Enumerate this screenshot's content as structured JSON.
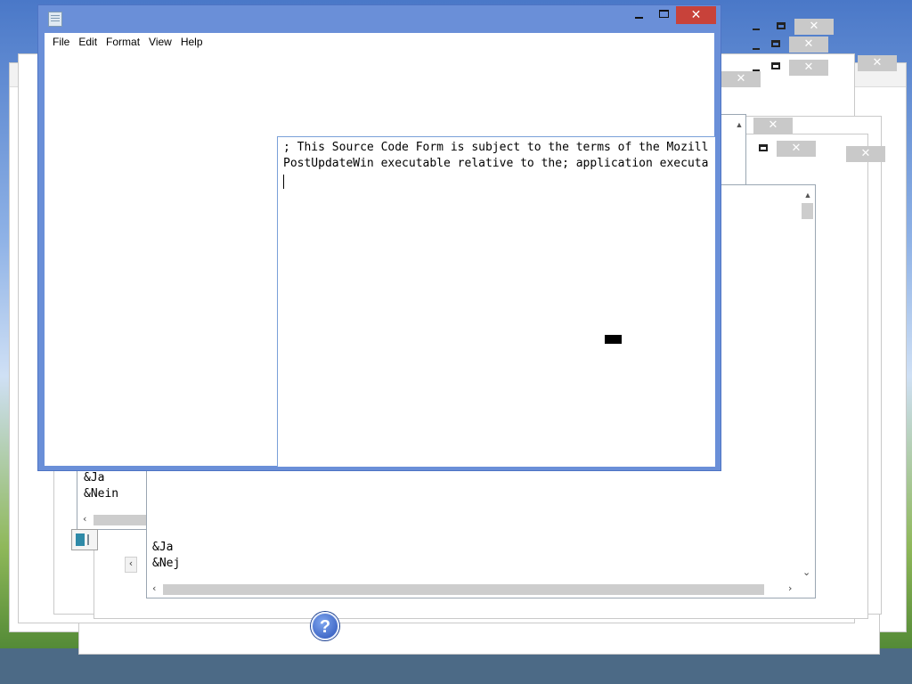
{
  "main_window": {
    "menu": [
      "File",
      "Edit",
      "Format",
      "View",
      "Help"
    ],
    "close_glyph": "✕"
  },
  "editor": {
    "line1": "; This Source Code Form is subject to the terms of the Mozill",
    "line2": "PostUpdateWin executable relative to the; application executa"
  },
  "dialog_de": {
    "line1": "&Ja",
    "line2": "&Nein"
  },
  "dialog_da": {
    "line1": "&Ja",
    "line2": "&Nej"
  },
  "background_close_glyph": "✕",
  "help_icon_glyph": "?",
  "colors": {
    "title_active": "#6a8fd8",
    "close_red": "#c8423a",
    "inactive_close": "#c9c9c9"
  }
}
